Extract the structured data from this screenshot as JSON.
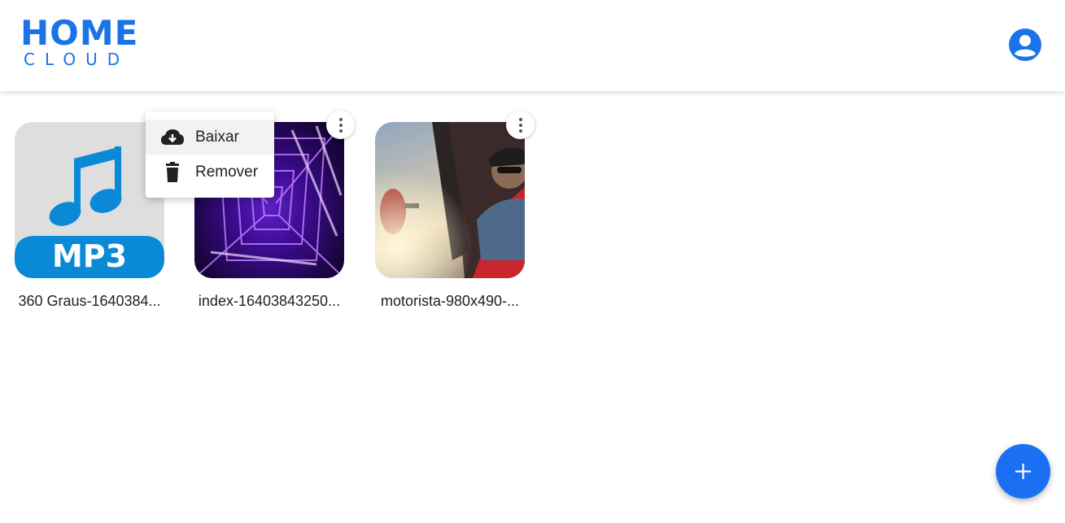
{
  "app": {
    "logo_top": "HOME",
    "logo_bottom": "CLOUD"
  },
  "colors": {
    "brand": "#1a73e8",
    "fab": "#1a6ff2",
    "mp3_blue": "#0a8ad6"
  },
  "header": {
    "account_icon": "account-circle-icon"
  },
  "files": [
    {
      "name": "360 Graus-1640384...",
      "type": "audio",
      "badge": "MP3",
      "icon": "music-note-icon"
    },
    {
      "name": "index-16403843250...",
      "type": "image",
      "icon": "image-thumbnail"
    },
    {
      "name": "motorista-980x490-...",
      "type": "image",
      "icon": "image-thumbnail"
    }
  ],
  "context_menu": {
    "items": [
      {
        "label": "Baixar",
        "icon": "cloud-download-icon"
      },
      {
        "label": "Remover",
        "icon": "trash-icon"
      }
    ]
  },
  "fab": {
    "icon": "plus-icon"
  }
}
